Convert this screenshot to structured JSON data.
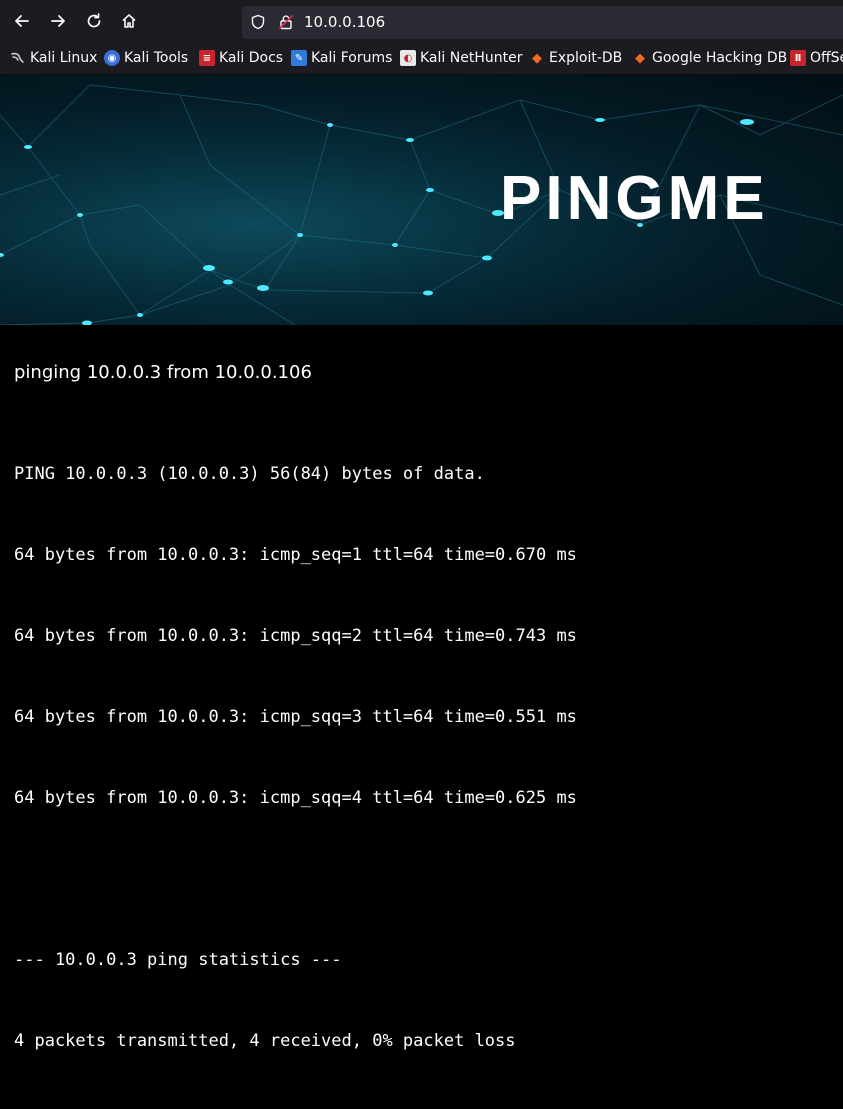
{
  "browser": {
    "url": "10.0.0.106"
  },
  "bookmarks": [
    {
      "label": "Kali Linux",
      "icon": "kali-dragon-icon"
    },
    {
      "label": "Kali Tools",
      "icon": "kali-tools-icon"
    },
    {
      "label": "Kali Docs",
      "icon": "kali-docs-icon"
    },
    {
      "label": "Kali Forums",
      "icon": "kali-forums-icon"
    },
    {
      "label": "Kali NetHunter",
      "icon": "kali-nethunter-icon"
    },
    {
      "label": "Exploit-DB",
      "icon": "exploit-db-icon"
    },
    {
      "label": "Google Hacking DB",
      "icon": "ghdb-icon"
    },
    {
      "label": "OffSe",
      "icon": "offsec-icon"
    }
  ],
  "banner": {
    "title": "PINGME"
  },
  "content": {
    "heading": "pinging 10.0.0.3 from 10.0.0.106",
    "output_lines": [
      "PING 10.0.0.3 (10.0.0.3) 56(84) bytes of data.",
      "64 bytes from 10.0.0.3: icmp_seq=1 ttl=64 time=0.670 ms",
      "64 bytes from 10.0.0.3: icmp_sqq=2 ttl=64 time=0.743 ms",
      "64 bytes from 10.0.0.3: icmp_sqq=3 ttl=64 time=0.551 ms",
      "64 bytes from 10.0.0.3: icmp_sqq=4 ttl=64 time=0.625 ms",
      "",
      "--- 10.0.0.3 ping statistics ---",
      "4 packets transmitted, 4 received, 0% packet loss"
    ]
  }
}
